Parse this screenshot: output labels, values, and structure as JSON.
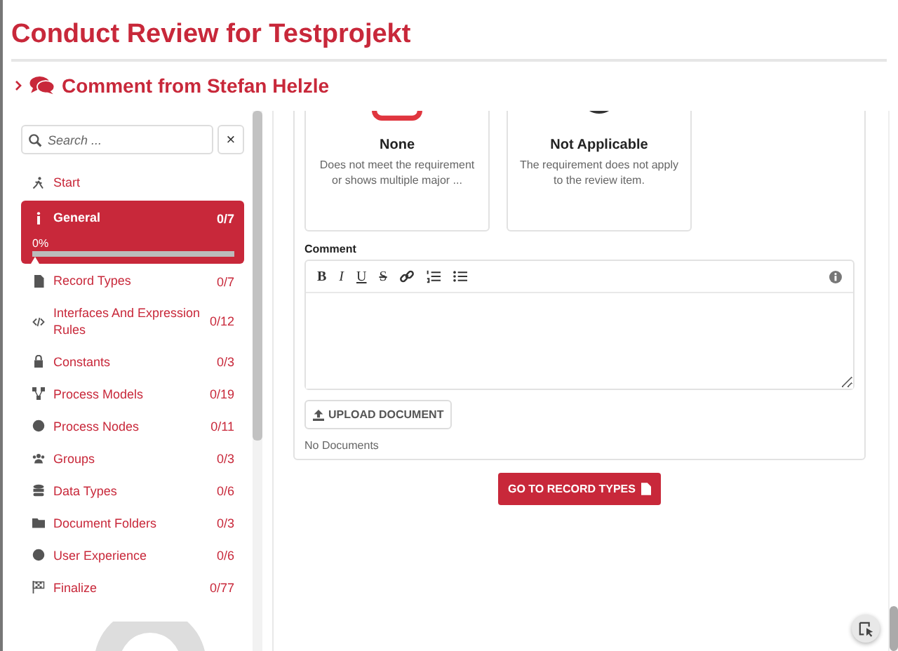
{
  "title": "Conduct Review for Testprojekt",
  "comment_header": {
    "label": "Comment from Stefan Helzle",
    "expanded": false
  },
  "search": {
    "placeholder": "Search ...",
    "clear": "×"
  },
  "nav": [
    {
      "label": "Start",
      "selected": false
    },
    {
      "label": "General",
      "count": "0/7",
      "selected": true,
      "progress_label": "0%",
      "level": 0
    },
    {
      "label": "Record Types",
      "count": "0/7",
      "selected": false
    },
    {
      "label": "Interfaces And Expression Rules",
      "count": "0/12",
      "selected": false
    },
    {
      "label": "Constants",
      "count": "0/3",
      "selected": false
    },
    {
      "label": "Process Models",
      "count": "0/19",
      "selected": false
    },
    {
      "label": "Process Nodes",
      "count": "0/11",
      "selected": false
    },
    {
      "label": "Groups",
      "count": "0/3",
      "selected": false
    },
    {
      "label": "Data Types",
      "count": "0/6",
      "selected": false
    },
    {
      "label": "Document Folders",
      "count": "0/3",
      "selected": false
    },
    {
      "label": "User Experience",
      "count": "0/6",
      "selected": false
    },
    {
      "label": "Finalize",
      "count": "0/77",
      "selected": false
    }
  ],
  "ratings": [
    {
      "title": "None",
      "description": "Does not meet the requirement or shows multiple major ..."
    },
    {
      "title": "Not Applicable",
      "description": "The requirement does not apply to the review item."
    }
  ],
  "comment": {
    "label": "Comment",
    "toolbar": [
      "B",
      "I",
      "U",
      "S"
    ]
  },
  "upload_button": "UPLOAD DOCUMENT",
  "documents_status": "No Documents",
  "next_button": "GO TO RECORD TYPES"
}
